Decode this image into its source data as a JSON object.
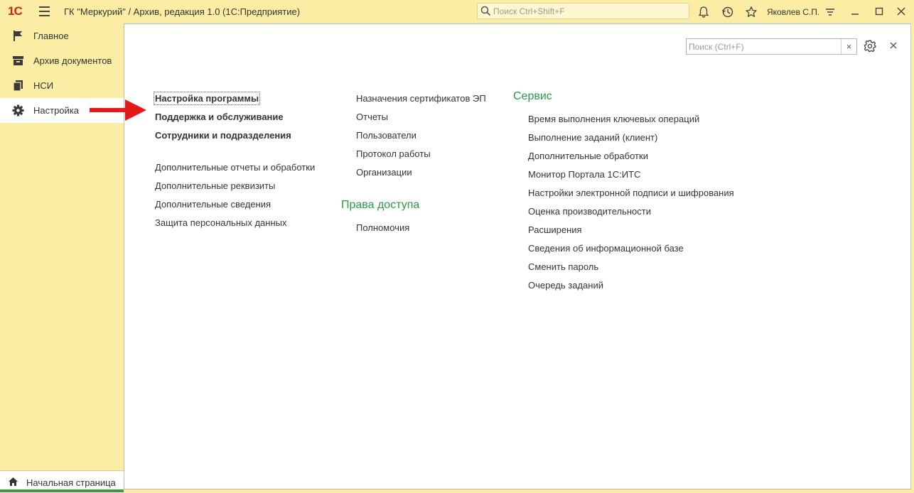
{
  "titlebar": {
    "logo": "1С",
    "app_title": "ГК \"Меркурий\" / Архив, редакция 1.0  (1С:Предприятие)",
    "search_placeholder": "Поиск Ctrl+Shift+F",
    "user_name": "Яковлев С.П."
  },
  "sidebar": {
    "items": [
      {
        "label": "Главное",
        "icon": "flag-icon"
      },
      {
        "label": "Архив документов",
        "icon": "archive-box-icon"
      },
      {
        "label": "НСИ",
        "icon": "documents-icon"
      },
      {
        "label": "Настройка",
        "icon": "gear-icon",
        "active": true
      }
    ],
    "home_label": "Начальная страница"
  },
  "panel": {
    "search_placeholder": "Поиск (Ctrl+F)",
    "clear_label": "×",
    "col1": {
      "main": [
        "Настройка программы",
        "Поддержка и обслуживание",
        "Сотрудники и подразделения"
      ],
      "extra": [
        "Дополнительные отчеты и обработки",
        "Дополнительные реквизиты",
        "Дополнительные сведения",
        "Защита персональных данных"
      ]
    },
    "col2": {
      "items": [
        "Назначения сертификатов ЭП",
        "Отчеты",
        "Пользователи",
        "Протокол работы",
        "Организации"
      ],
      "access_header": "Права доступа",
      "access_items": [
        "Полномочия"
      ]
    },
    "col3": {
      "header": "Сервис",
      "items": [
        "Время выполнения ключевых операций",
        "Выполнение заданий (клиент)",
        "Дополнительные обработки",
        "Монитор Портала 1С:ИТС",
        "Настройки электронной подписи и шифрования",
        "Оценка производительности",
        "Расширения",
        "Сведения об информационной базе",
        "Сменить пароль",
        "Очередь заданий"
      ]
    }
  },
  "colors": {
    "background": "#fbeda3",
    "group_header": "#2a9a4a",
    "arrow": "#e3191c",
    "logo": "#d8221c"
  }
}
